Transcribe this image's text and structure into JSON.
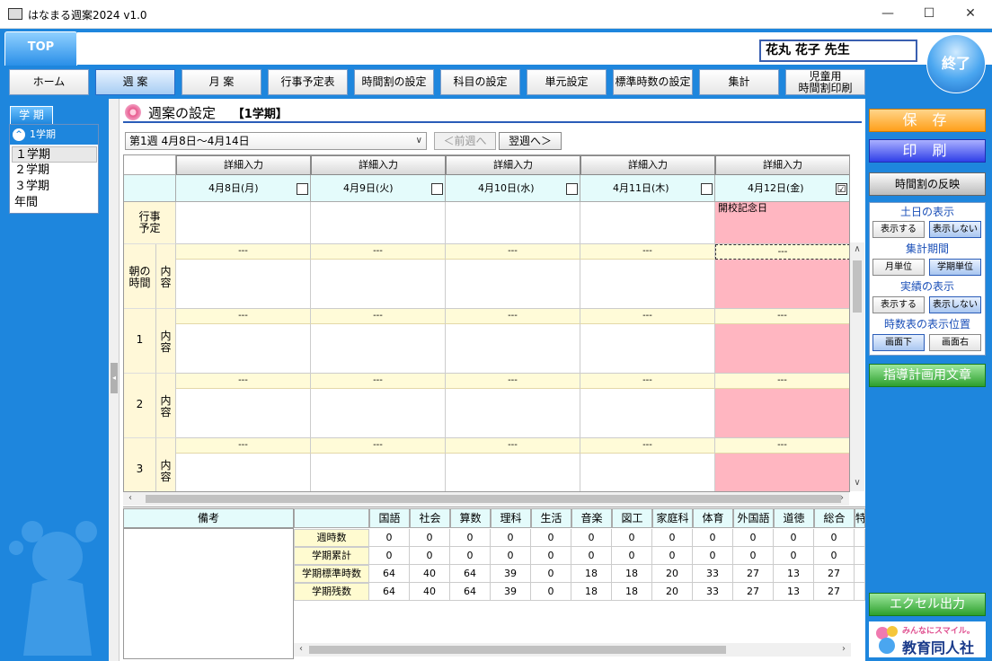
{
  "window": {
    "title": "はなまる週案2024 v1.0",
    "icon": "app-icon",
    "min": "—",
    "max": "☐",
    "close": "✕"
  },
  "top_tab": "TOP",
  "teacher": "花丸 花子 先生",
  "exit_label": "終了",
  "menu": [
    {
      "label": "ホーム"
    },
    {
      "label": "週 案",
      "active": true
    },
    {
      "label": "月 案"
    },
    {
      "label": "行事予定表"
    },
    {
      "label": "時間割の設定"
    },
    {
      "label": "科目の設定"
    },
    {
      "label": "単元設定"
    },
    {
      "label": "標準時数の設定"
    },
    {
      "label": "集計"
    },
    {
      "label_line1": "児童用",
      "label_line2": "時間割印刷"
    }
  ],
  "sidebar": {
    "tab": "学 期",
    "selected_header": "1学期",
    "items": [
      "１学期",
      "２学期",
      "３学期",
      "年間"
    ]
  },
  "section": {
    "title": "週案の設定",
    "term": "【1学期】"
  },
  "week": {
    "selected": "第1週 4月8日～4月14日",
    "prev": "＜前週へ",
    "next": "翌週へ＞"
  },
  "grid": {
    "detail_label": "詳細入力",
    "days": [
      {
        "label": "4月8日(月)",
        "checked": false
      },
      {
        "label": "4月9日(火)",
        "checked": false
      },
      {
        "label": "4月10日(水)",
        "checked": false
      },
      {
        "label": "4月11日(木)",
        "checked": false
      },
      {
        "label": "4月12日(金)",
        "checked": true
      }
    ],
    "event_row_label_1": "行事",
    "event_row_label_2": "予定",
    "events": [
      "",
      "",
      "",
      "",
      "開校記念日"
    ],
    "dash": "---",
    "content_label_1": "内",
    "content_label_2": "容",
    "periods": [
      {
        "label_1": "朝の",
        "label_2": "時間"
      },
      {
        "label_1": "1",
        "label_2": ""
      },
      {
        "label_1": "2",
        "label_2": ""
      },
      {
        "label_1": "3",
        "label_2": ""
      }
    ],
    "check_mark": "☑"
  },
  "bottom": {
    "biko": "備考",
    "subjects": [
      "国語",
      "社会",
      "算数",
      "理科",
      "生活",
      "音楽",
      "図工",
      "家庭科",
      "体育",
      "外国語",
      "道徳",
      "総合",
      "特"
    ],
    "rows": [
      {
        "label": "週時数",
        "values": [
          "0",
          "0",
          "0",
          "0",
          "0",
          "0",
          "0",
          "0",
          "0",
          "0",
          "0",
          "0"
        ]
      },
      {
        "label": "学期累計",
        "values": [
          "0",
          "0",
          "0",
          "0",
          "0",
          "0",
          "0",
          "0",
          "0",
          "0",
          "0",
          "0"
        ]
      },
      {
        "label": "学期標準時数",
        "values": [
          "64",
          "40",
          "64",
          "39",
          "0",
          "18",
          "18",
          "20",
          "33",
          "27",
          "13",
          "27"
        ]
      },
      {
        "label": "学期残数",
        "values": [
          "64",
          "40",
          "64",
          "39",
          "0",
          "18",
          "18",
          "20",
          "33",
          "27",
          "13",
          "27"
        ]
      }
    ]
  },
  "right": {
    "save": "保 存",
    "print": "印 刷",
    "reflect": "時間割の反映",
    "weekend_label": "土日の表示",
    "weekend_show": "表示する",
    "weekend_hide": "表示しない",
    "period_label": "集計期間",
    "period_month": "月単位",
    "period_term": "学期単位",
    "actual_label": "実績の表示",
    "actual_show": "表示する",
    "actual_hide": "表示しない",
    "pos_label": "時数表の表示位置",
    "pos_bottom": "画面下",
    "pos_right": "画面右",
    "guide": "指導計画用文章",
    "excel": "エクセル出力",
    "logo_small": "みんなにスマイル。",
    "logo_big": "教育同人社"
  },
  "colors": {
    "blue": "#1e86dd",
    "pink": "#ffb6c1",
    "cyan": "#e4fbfb",
    "yellow": "#fffbd8"
  }
}
